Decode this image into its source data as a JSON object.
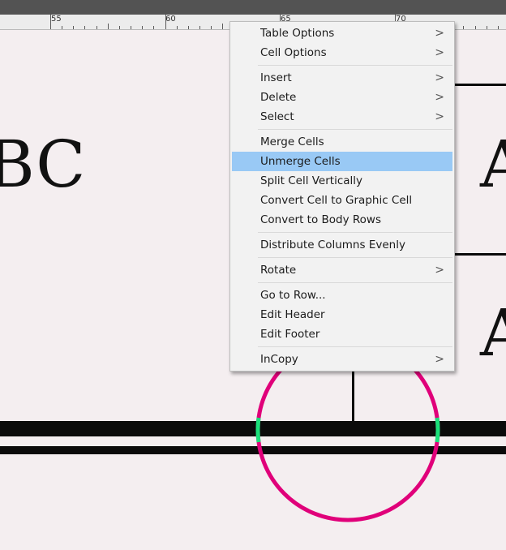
{
  "ruler": {
    "labels": [
      "55",
      "60",
      "65",
      "70"
    ]
  },
  "canvas": {
    "text_left": "BC",
    "text_right_top": "A",
    "text_right_bottom": "A"
  },
  "context_menu": {
    "items": [
      {
        "label": "Table Options",
        "submenu": true
      },
      {
        "label": "Cell Options",
        "submenu": true
      },
      {
        "label": "Insert",
        "submenu": true
      },
      {
        "label": "Delete",
        "submenu": true
      },
      {
        "label": "Select",
        "submenu": true
      },
      {
        "label": "Merge Cells",
        "submenu": false
      },
      {
        "label": "Unmerge Cells",
        "submenu": false,
        "highlighted": true
      },
      {
        "label": "Split Cell Vertically",
        "submenu": false
      },
      {
        "label": "Convert Cell to Graphic Cell",
        "submenu": false
      },
      {
        "label": "Convert to Body Rows",
        "submenu": false
      },
      {
        "label": "Distribute Columns Evenly",
        "submenu": false
      },
      {
        "label": "Rotate",
        "submenu": true
      },
      {
        "label": "Go to Row...",
        "submenu": false
      },
      {
        "label": "Edit Header",
        "submenu": false
      },
      {
        "label": "Edit Footer",
        "submenu": false
      },
      {
        "label": "InCopy",
        "submenu": true
      }
    ],
    "submenu_arrow": ">"
  },
  "colors": {
    "highlight": "#99c9f5",
    "circle_magenta": "#e0007a",
    "circle_green": "#19e07a"
  }
}
